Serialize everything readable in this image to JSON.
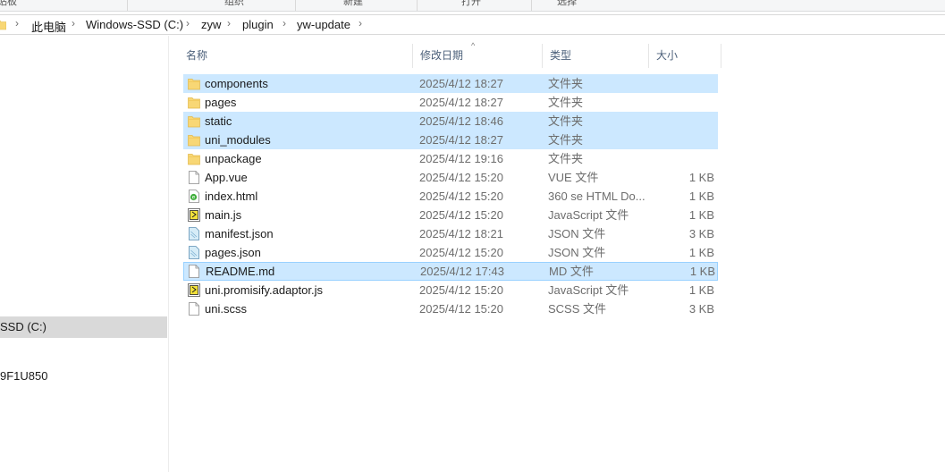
{
  "ribbon": {
    "groups": [
      "剪贴板",
      "组织",
      "新建",
      "打开",
      "选择"
    ]
  },
  "address": {
    "crumbs": [
      "此电脑",
      "Windows-SSD (C:)",
      "zyw",
      "plugin",
      "yw-update"
    ]
  },
  "nav": {
    "items": [
      "SSD (C:)",
      "9F1U850"
    ]
  },
  "columns": {
    "name": "名称",
    "date": "修改日期",
    "type": "类型",
    "size": "大小"
  },
  "files": [
    {
      "name": "components",
      "date": "2025/4/12 18:27",
      "type": "文件夹",
      "size": "",
      "icon": "folder-icon",
      "selected": true
    },
    {
      "name": "pages",
      "date": "2025/4/12 18:27",
      "type": "文件夹",
      "size": "",
      "icon": "folder-icon",
      "selected": false
    },
    {
      "name": "static",
      "date": "2025/4/12 18:46",
      "type": "文件夹",
      "size": "",
      "icon": "folder-icon",
      "selected": true
    },
    {
      "name": "uni_modules",
      "date": "2025/4/12 18:27",
      "type": "文件夹",
      "size": "",
      "icon": "folder-icon",
      "selected": true
    },
    {
      "name": "unpackage",
      "date": "2025/4/12 19:16",
      "type": "文件夹",
      "size": "",
      "icon": "folder-icon",
      "selected": false
    },
    {
      "name": "App.vue",
      "date": "2025/4/12 15:20",
      "type": "VUE 文件",
      "size": "1 KB",
      "icon": "file-icon",
      "selected": false
    },
    {
      "name": "index.html",
      "date": "2025/4/12 15:20",
      "type": "360 se HTML Do...",
      "size": "1 KB",
      "icon": "html-file-icon",
      "selected": false
    },
    {
      "name": "main.js",
      "date": "2025/4/12 15:20",
      "type": "JavaScript 文件",
      "size": "1 KB",
      "icon": "js-file-icon",
      "selected": false
    },
    {
      "name": "manifest.json",
      "date": "2025/4/12 18:21",
      "type": "JSON 文件",
      "size": "3 KB",
      "icon": "json-file-icon",
      "selected": false
    },
    {
      "name": "pages.json",
      "date": "2025/4/12 15:20",
      "type": "JSON 文件",
      "size": "1 KB",
      "icon": "json-file-icon",
      "selected": false
    },
    {
      "name": "README.md",
      "date": "2025/4/12 17:43",
      "type": "MD 文件",
      "size": "1 KB",
      "icon": "file-icon",
      "selected": true,
      "focused": true
    },
    {
      "name": "uni.promisify.adaptor.js",
      "date": "2025/4/12 15:20",
      "type": "JavaScript 文件",
      "size": "1 KB",
      "icon": "js-file-icon",
      "selected": false
    },
    {
      "name": "uni.scss",
      "date": "2025/4/12 15:20",
      "type": "SCSS 文件",
      "size": "3 KB",
      "icon": "file-icon",
      "selected": false
    }
  ],
  "colors": {
    "selection": "#cce8ff",
    "focus_border": "#99d1ff",
    "header_text": "#4c607a",
    "nav_selected": "#d9d9d9"
  }
}
